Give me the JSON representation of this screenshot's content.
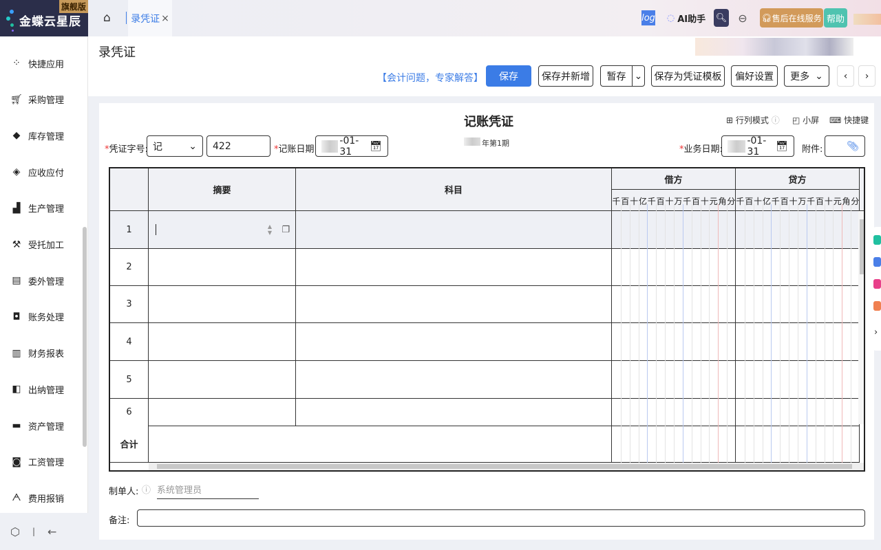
{
  "brand": {
    "name": "金蝶云星辰",
    "edition": "旗舰版"
  },
  "sidebar": {
    "items": [
      {
        "label": "快捷应用",
        "icon": "apps-icon"
      },
      {
        "label": "采购管理",
        "icon": "cart-icon"
      },
      {
        "label": "库存管理",
        "icon": "box-icon"
      },
      {
        "label": "应收应付",
        "icon": "diamond-icon"
      },
      {
        "label": "生产管理",
        "icon": "factory-icon"
      },
      {
        "label": "受托加工",
        "icon": "tools-icon"
      },
      {
        "label": "委外管理",
        "icon": "book-icon"
      },
      {
        "label": "账务处理",
        "icon": "ledger-icon"
      },
      {
        "label": "财务报表",
        "icon": "report-icon"
      },
      {
        "label": "出纳管理",
        "icon": "cashier-icon"
      },
      {
        "label": "资产管理",
        "icon": "asset-icon"
      },
      {
        "label": "工资管理",
        "icon": "salary-icon"
      },
      {
        "label": "费用报销",
        "icon": "expense-icon"
      }
    ]
  },
  "topbar": {
    "tab": "录凭证",
    "ai": "AI助手",
    "log": "log",
    "service": "售后在线服务",
    "help": "帮助"
  },
  "page": {
    "title": "录凭证",
    "expert_link": "【会计问题，专家解答】",
    "buttons": {
      "save": "保存",
      "save_new": "保存并新增",
      "draft": "暂存",
      "save_template": "保存为凭证模板",
      "prefs": "偏好设置",
      "more": "更多"
    }
  },
  "voucher": {
    "title": "记账凭证",
    "period": "年第1期",
    "mode": "行列模式",
    "small": "小屏",
    "shortcut": "快捷键",
    "word_label": "凭证字号:",
    "word": "记",
    "number": "422",
    "date_label": "记账日期:",
    "date": "-01-31",
    "biz_date_label": "业务日期:",
    "biz_date": "-01-31",
    "attach_label": "附件:",
    "columns": {
      "summary": "摘要",
      "account": "科目",
      "debit": "借方",
      "credit": "贷方"
    },
    "digits": [
      "千",
      "百",
      "十",
      "亿",
      "千",
      "百",
      "十",
      "万",
      "千",
      "百",
      "十",
      "元",
      "角",
      "分"
    ],
    "rows": [
      "1",
      "2",
      "3",
      "4",
      "5",
      "6"
    ],
    "total": "合计",
    "maker_label": "制单人:",
    "maker": "系统管理员",
    "note_label": "备注:"
  },
  "colors": {
    "primary": "#3b7ce6",
    "sidebar_dark": "#2b2e4a",
    "service": "#d29a5a",
    "help": "#4fc3b0"
  }
}
